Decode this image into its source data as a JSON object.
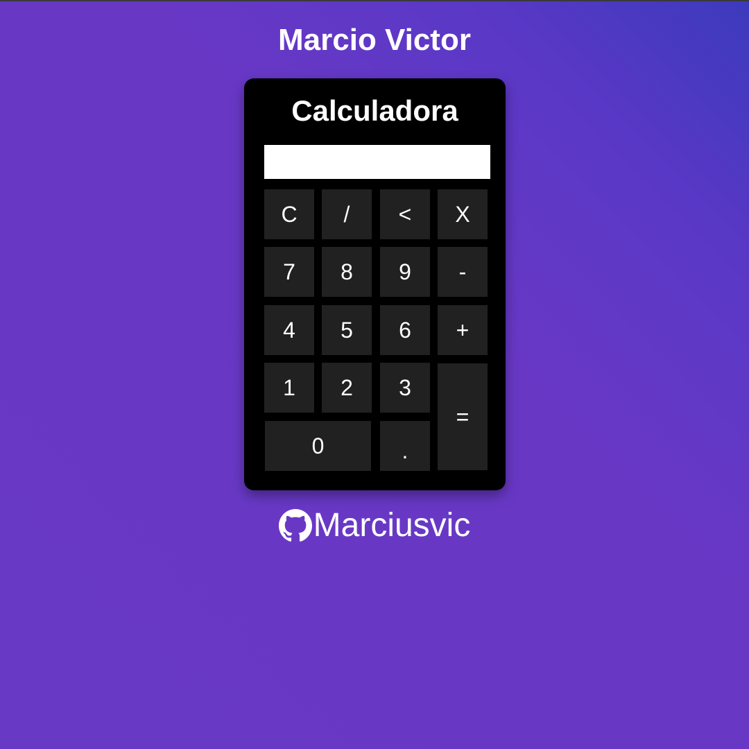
{
  "header": {
    "title": "Marcio Victor"
  },
  "calculator": {
    "title": "Calculadora",
    "display_value": "",
    "buttons": {
      "clear": "C",
      "divide": "/",
      "backspace": "<",
      "multiply": "X",
      "seven": "7",
      "eight": "8",
      "nine": "9",
      "minus": "-",
      "four": "4",
      "five": "5",
      "six": "6",
      "plus": "+",
      "one": "1",
      "two": "2",
      "three": "3",
      "equals": "=",
      "zero": "0",
      "decimal": "."
    }
  },
  "footer": {
    "icon": "github-icon",
    "username": "Marciusvic"
  },
  "colors": {
    "background_start": "#3c3abd",
    "background_end": "#6839c5",
    "calculator_body": "#000000",
    "button": "#212121",
    "display": "#ffffff",
    "text": "#ffffff"
  }
}
